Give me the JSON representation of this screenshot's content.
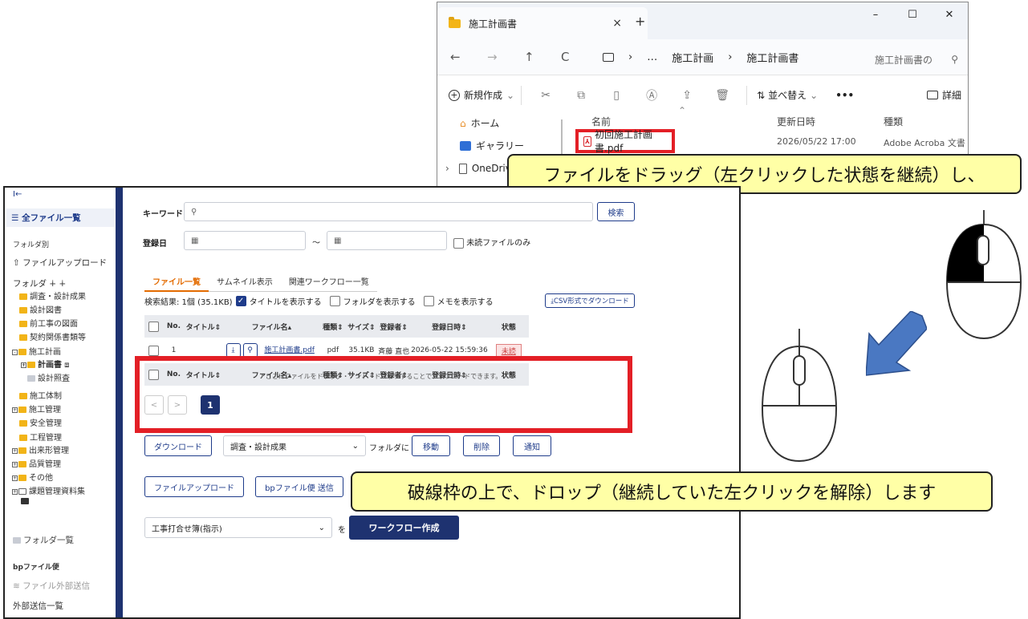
{
  "explorer": {
    "tab_title": "施工計画書",
    "tab_close": "×",
    "new_tab": "+",
    "window_buttons": [
      "–",
      "☐",
      "✕"
    ],
    "nav": [
      "←",
      "→",
      "↑",
      "C"
    ],
    "path": [
      "…",
      "施工計画",
      "›",
      "施工計画書"
    ],
    "path_sep": "›",
    "search_placeholder": "施工計画書の",
    "toolbar": {
      "new": "新規作成",
      "sort": "並べ替え",
      "more": "•••",
      "details": "詳細"
    },
    "sidebar": {
      "home": "ホーム",
      "gallery": "ギャラリー",
      "onedrive": "OneDriv"
    },
    "columns": {
      "name": "名前",
      "modified": "更新日時",
      "type": "種類"
    },
    "file": {
      "name": "初回施工計画書.pdf",
      "modified": "2026/05/22 17:00",
      "type": "Adobe Acroba 文書"
    }
  },
  "callouts": {
    "drag": "ファイルをドラッグ（左クリックした状態を継続）し、",
    "drop": "破線枠の上で、ドロップ（継続していた左クリックを解除）します"
  },
  "sidebar": {
    "collapse": "I←",
    "all_files": "☰ 全ファイル一覧",
    "folder_section": "フォルダ別",
    "file_upload": "⇧ ファイルアップロード",
    "folder_header": "フォルダ ∔ ∔",
    "folders": [
      "調査・設計成果",
      "設計図書",
      "前工事の図面",
      "契約関係書類等",
      "施工計画",
      "計画書",
      "設計照査",
      "施工体制",
      "施工管理",
      "安全管理",
      "工程管理",
      "出来形管理",
      "品質管理",
      "その他",
      "課題管理資料集"
    ],
    "folder_list": "フォルダ一覧",
    "bp_section": "bpファイル便",
    "external_send": "ファイル外部送信",
    "external_list": "外部送信一覧"
  },
  "search": {
    "keyword_label": "キーワード",
    "search_button": "検索",
    "date_label": "登録日",
    "date_sep": "～",
    "unread_only": "未読ファイルのみ"
  },
  "tabs": [
    "ファイル一覧",
    "サムネイル表示",
    "関連ワークフロー一覧"
  ],
  "results": {
    "summary": "検索結果: 1個 (35.1KB)",
    "show_title": "タイトルを表示する",
    "show_folder": "フォルダを表示する",
    "show_memo": "メモを表示する",
    "csv_button": "⤓CSV形式でダウンロード"
  },
  "table": {
    "headers": [
      "No.",
      "タイトル⇕",
      "ファイル名▴",
      "種類⇕",
      "サイズ⇕",
      "登録者⇕",
      "登録日時⇕",
      "状態"
    ],
    "rows": [
      {
        "no": "1",
        "title": "",
        "filename": "施工計画書.pdf",
        "kind": "pdf",
        "size": "35.1KB",
        "owner": "斉藤 直也",
        "date": "2026-05-22 15:59:36",
        "status": "未読"
      }
    ]
  },
  "pager": {
    "prev": "<",
    "next": ">",
    "current": "1"
  },
  "actions": {
    "download": "ダウンロード",
    "folder_select": "調査・設計成果",
    "folder_suffix": "フォルダに",
    "move": "移動",
    "delete": "削除",
    "notify": "通知",
    "file_upload": "ファイルアップロード",
    "bp_send": "bpファイル便 送信",
    "workflow_select": "工事打合せ簿(指示)",
    "workflow_suffix": "を",
    "workflow_create": "ワークフロー作成"
  },
  "dropzone": "ここにファイルをドラッグ・アンド・ドロップすることでアップロードできます。",
  "colors": {
    "navy": "#1e3270",
    "red_highlight": "#e31f26",
    "callout": "#ffffa6",
    "arrow": "#4a78c2"
  }
}
